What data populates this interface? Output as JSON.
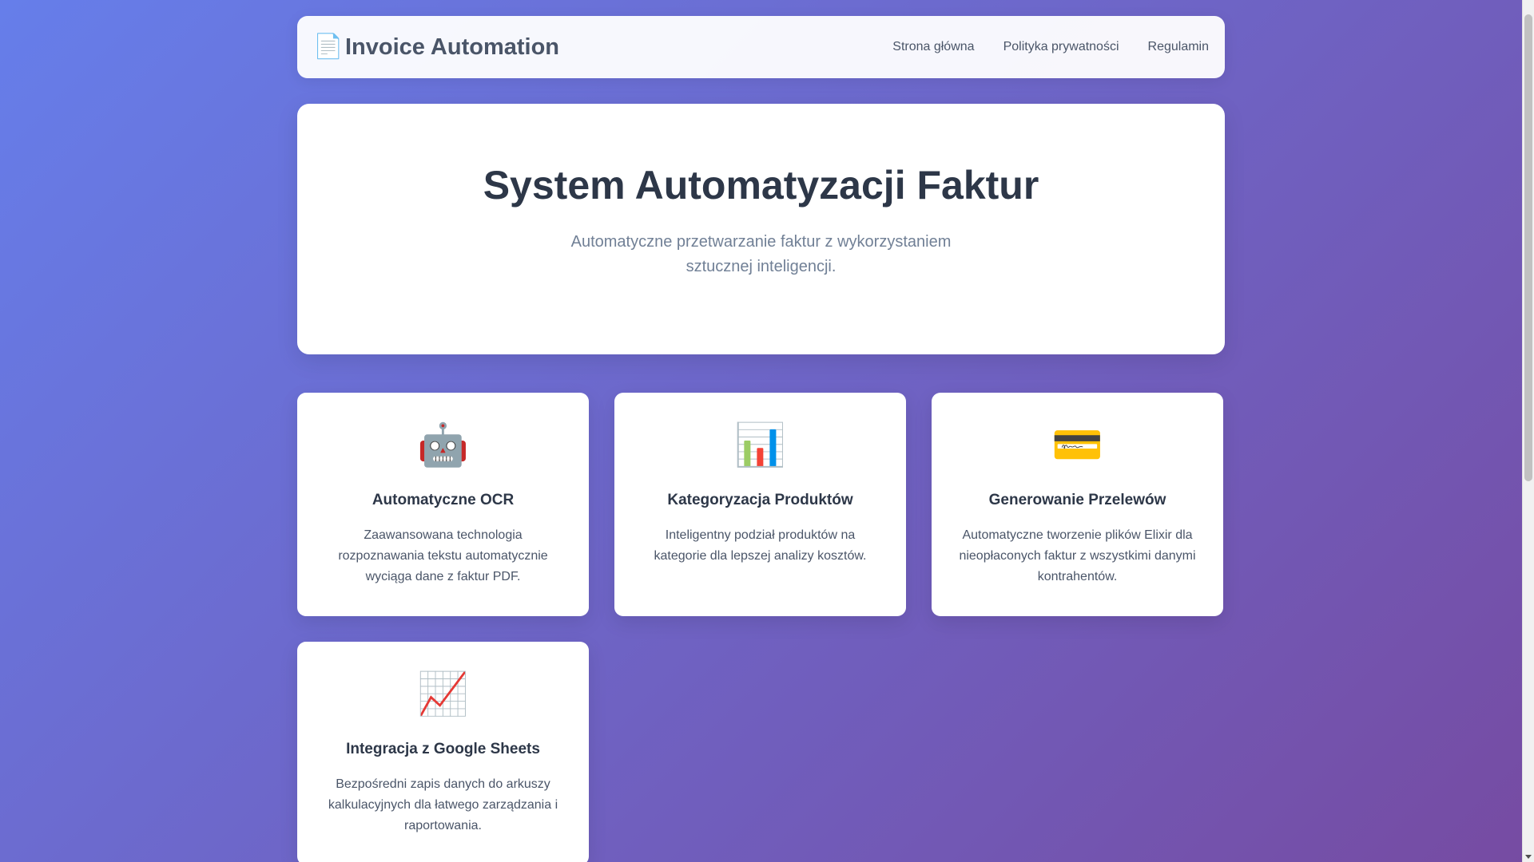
{
  "header": {
    "brand_icon": "📄",
    "brand_title": "Invoice Automation",
    "nav": [
      {
        "label": "Strona główna"
      },
      {
        "label": "Polityka prywatności"
      },
      {
        "label": "Regulamin"
      }
    ]
  },
  "hero": {
    "title": "System Automatyzacji Faktur",
    "subtitle": "Automatyczne przetwarzanie faktur z wykorzystaniem sztucznej inteligencji."
  },
  "features": [
    {
      "icon": "🤖",
      "icon_name": "robot-icon",
      "title": "Automatyczne OCR",
      "description": "Zaawansowana technologia rozpoznawania tekstu automatycznie wyciąga dane z faktur PDF."
    },
    {
      "icon": "📊",
      "icon_name": "bar-chart-icon",
      "title": "Kategoryzacja Produktów",
      "description": "Inteligentny podział produktów na kategorie dla lepszej analizy kosztów."
    },
    {
      "icon": "💳",
      "icon_name": "credit-card-icon",
      "title": "Generowanie Przelewów",
      "description": "Automatyczne tworzenie plików Elixir dla nieopłaconych faktur z wszystkimi danymi kontrahentów."
    },
    {
      "icon": "📈",
      "icon_name": "trend-chart-icon",
      "title": "Integracja z Google Sheets",
      "description": "Bezpośredni zapis danych do arkuszy kalkulacyjnych dla łatwego zarządzania i raportowania."
    }
  ],
  "colors": {
    "gradient_start": "#667eea",
    "gradient_end": "#764ba2",
    "heading": "#2d3748",
    "muted": "#718096"
  }
}
